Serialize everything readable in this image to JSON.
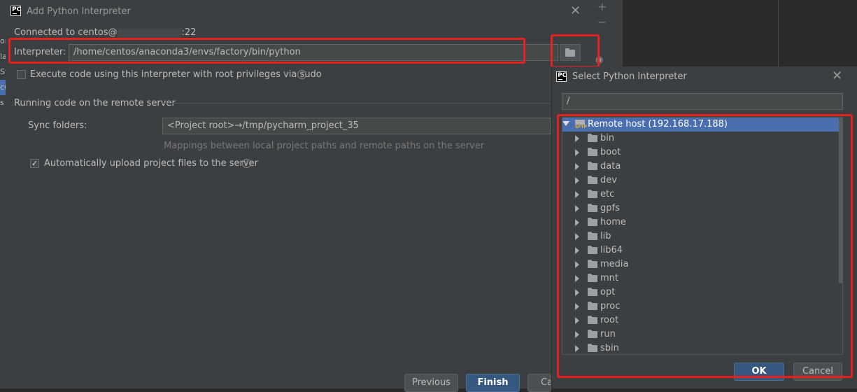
{
  "main_dialog": {
    "title": "Add Python Interpreter",
    "connected_prefix": "Connected to centos@",
    "connected_suffix": ":22",
    "interpreter_label": "Interpreter:",
    "interpreter_value": "/home/centos/anaconda3/envs/factory/bin/python",
    "sudo_label": "Execute code using this interpreter with root privileges via sudo",
    "section_title": "Running code on the remote server",
    "sync_label": "Sync folders:",
    "sync_value": "<Project root>→/tmp/pycharm_project_35",
    "mapping_hint": "Mappings between local project paths and remote paths on the server",
    "auto_upload_label": "Automatically upload project files to the server",
    "auto_upload_checked": true,
    "buttons": {
      "previous": "Previous",
      "finish": "Finish",
      "cancel_partial": "Ca"
    }
  },
  "background": {
    "left_fragments": [
      "or",
      "la",
      "St",
      "cu",
      "s"
    ]
  },
  "select_dialog": {
    "title": "Select Python Interpreter",
    "path_value": "/",
    "root_label": "Remote host (192.168.17.188)",
    "sftp_badge": "SFTP",
    "folders": [
      "bin",
      "boot",
      "data",
      "dev",
      "etc",
      "gpfs",
      "home",
      "lib",
      "lib64",
      "media",
      "mnt",
      "opt",
      "proc",
      "root",
      "run",
      "sbin"
    ],
    "buttons": {
      "ok": "OK",
      "cancel": "Cancel"
    }
  },
  "colors": {
    "accent": "#365880",
    "highlight": "#e8211f",
    "selection": "#4b6eaf"
  }
}
